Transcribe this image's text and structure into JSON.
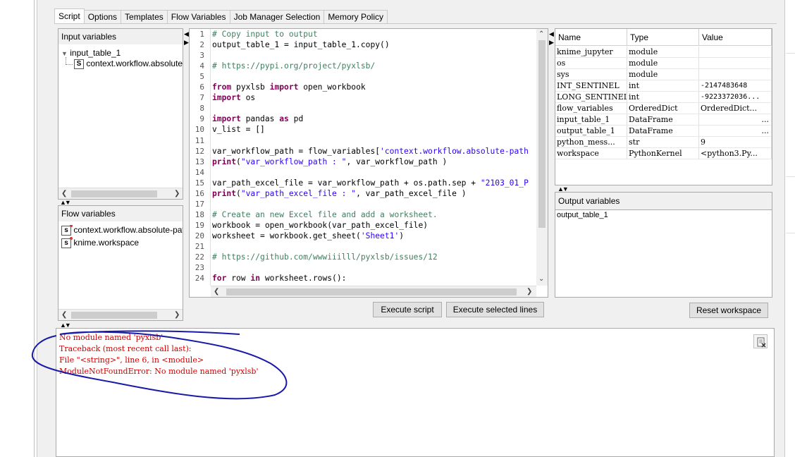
{
  "tabs": [
    "Script",
    "Options",
    "Templates",
    "Flow Variables",
    "Job Manager Selection",
    "Memory Policy"
  ],
  "input_variables": {
    "header": "Input variables",
    "tree_root": "input_table_1",
    "tree_child": "context.workflow.absolute-p"
  },
  "flow_variables": {
    "header": "Flow variables",
    "items": [
      "context.workflow.absolute-path",
      "knime.workspace"
    ]
  },
  "editor": {
    "line_numbers": [
      "1",
      "2",
      "3",
      "4",
      "5",
      "6",
      "7",
      "8",
      "9",
      "10",
      "11",
      "12",
      "13",
      "14",
      "15",
      "16",
      "17",
      "18",
      "19",
      "20",
      "21",
      "22",
      "23",
      "24"
    ],
    "lines": [
      "# Copy input to output",
      "output_table_1 = input_table_1.copy()",
      "",
      "# https://pypi.org/project/pyxlsb/",
      "",
      "from pyxlsb import open_workbook",
      "import os",
      "",
      "import pandas as pd",
      "v_list = []",
      "",
      "var_workflow_path = flow_variables['context.workflow.absolute-path",
      "print(\"var_workflow_path : \", var_workflow_path )",
      "",
      "var_path_excel_file = var_workflow_path + os.path.sep + \"2103_01_P",
      "print(\"var_path_excel_file : \", var_path_excel_file )",
      "",
      "# Create an new Excel file and add a worksheet.",
      "workbook = open_workbook(var_path_excel_file)",
      "worksheet = workbook.get_sheet('Sheet1')",
      "",
      "# https://github.com/wwwiiilll/pyxlsb/issues/12",
      "",
      "for row in worksheet.rows():"
    ]
  },
  "buttons": {
    "execute_script": "Execute script",
    "execute_selected": "Execute selected lines",
    "reset_workspace": "Reset workspace"
  },
  "variables_table": {
    "columns": [
      "Name",
      "Type",
      "Value"
    ],
    "rows": [
      [
        "knime_jupyter",
        "module",
        ""
      ],
      [
        "os",
        "module",
        ""
      ],
      [
        "sys",
        "module",
        ""
      ],
      [
        "INT_SENTINEL",
        "int",
        "-2147483648"
      ],
      [
        "LONG_SENTINEL",
        "int",
        "-9223372036..."
      ],
      [
        "flow_variables",
        "OrderedDict",
        "OrderedDict..."
      ],
      [
        "input_table_1",
        "DataFrame",
        "..."
      ],
      [
        "output_table_1",
        "DataFrame",
        "..."
      ],
      [
        "python_mess...",
        "str",
        "9"
      ],
      [
        "workspace",
        "PythonKernel",
        "<python3.Py..."
      ]
    ]
  },
  "output_variables": {
    "header": "Output variables",
    "items": [
      "output_table_1"
    ]
  },
  "console": {
    "lines": [
      "No module named 'pyxlsb'",
      "Traceback (most recent call last):",
      "File \"<string>\", line 6, in <module>",
      "ModuleNotFoundError: No module named 'pyxlsb'"
    ],
    "error_color": "#cc0000",
    "annotation_color": "#1a1aa8"
  }
}
